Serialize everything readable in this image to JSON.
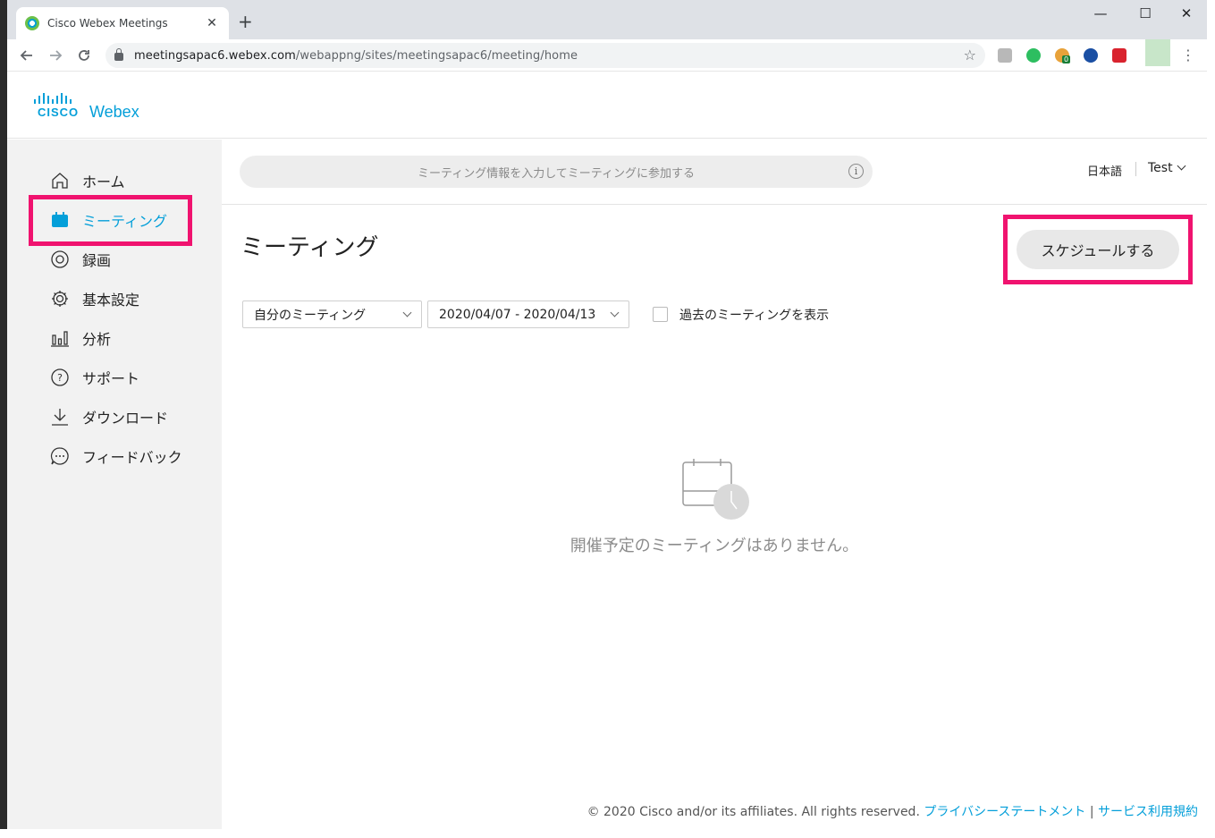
{
  "browser": {
    "tab_title": "Cisco Webex Meetings",
    "tab_close": "✕",
    "new_tab": "+",
    "window_controls": {
      "minimize": "—",
      "maximize": "☐",
      "close": "✕"
    },
    "url_domain": "meetingsapac6.webex.com",
    "url_path": "/webappng/sites/meetingsapac6/meeting/home",
    "extension_badge": "0"
  },
  "brand": {
    "cisco": "CISCO",
    "product": "Webex"
  },
  "sidebar": {
    "items": [
      {
        "label": "ホーム",
        "icon": "home-icon"
      },
      {
        "label": "ミーティング",
        "icon": "calendar-icon"
      },
      {
        "label": "録画",
        "icon": "recording-icon"
      },
      {
        "label": "基本設定",
        "icon": "gear-icon"
      },
      {
        "label": "分析",
        "icon": "analytics-icon"
      },
      {
        "label": "サポート",
        "icon": "help-icon"
      },
      {
        "label": "ダウンロード",
        "icon": "download-icon"
      },
      {
        "label": "フィードバック",
        "icon": "feedback-icon"
      }
    ]
  },
  "header": {
    "join_placeholder": "ミーティング情報を入力してミーティングに参加する",
    "info_glyph": "i",
    "language": "日本語",
    "user": "Test"
  },
  "main": {
    "title": "ミーティング",
    "schedule_label": "スケジュールする",
    "filter_owner": "自分のミーティング",
    "date_range": "2020/04/07 - 2020/04/13",
    "show_past_label": "過去のミーティングを表示",
    "empty_message": "開催予定のミーティングはありません。"
  },
  "footer": {
    "copyright": "© 2020 Cisco and/or its affiliates. All rights reserved.",
    "privacy_link": "プライバシーステートメント",
    "separator": "|",
    "terms_link": "サービス利用規約"
  },
  "colors": {
    "accent": "#049fd9",
    "highlight": "#f0136f"
  }
}
